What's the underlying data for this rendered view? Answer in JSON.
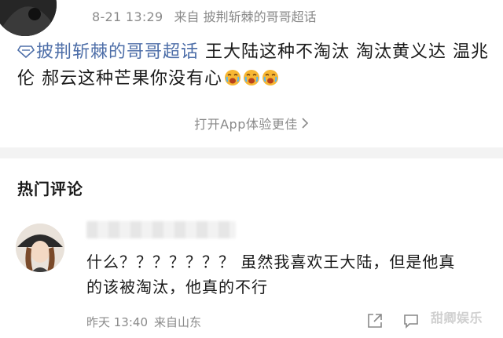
{
  "post": {
    "time": "8-21 13:29",
    "source": "来自 披荆斩棘的哥哥超话",
    "topic": "披荆斩棘的哥哥超话",
    "text": " 王大陆这种不淘汰 淘汰黄义达 温兆伦 郝云这种芒果你没有心",
    "emoji_icon": "crying-face-icon",
    "open_app": "打开App体验更佳"
  },
  "comments_section": {
    "title": "热门评论"
  },
  "comment": {
    "text": "什么？？？？？？？ 虽然我喜欢王大陆，但是他真的该被淘汰，他真的不行",
    "time": "昨天 13:40",
    "source": "来自山东"
  },
  "watermark": {
    "text": "甜卿娱乐"
  },
  "colors": {
    "topic_link": "#4d6ea8",
    "meta_gray": "#8a8a8a",
    "divider": "#f3f3f3"
  }
}
